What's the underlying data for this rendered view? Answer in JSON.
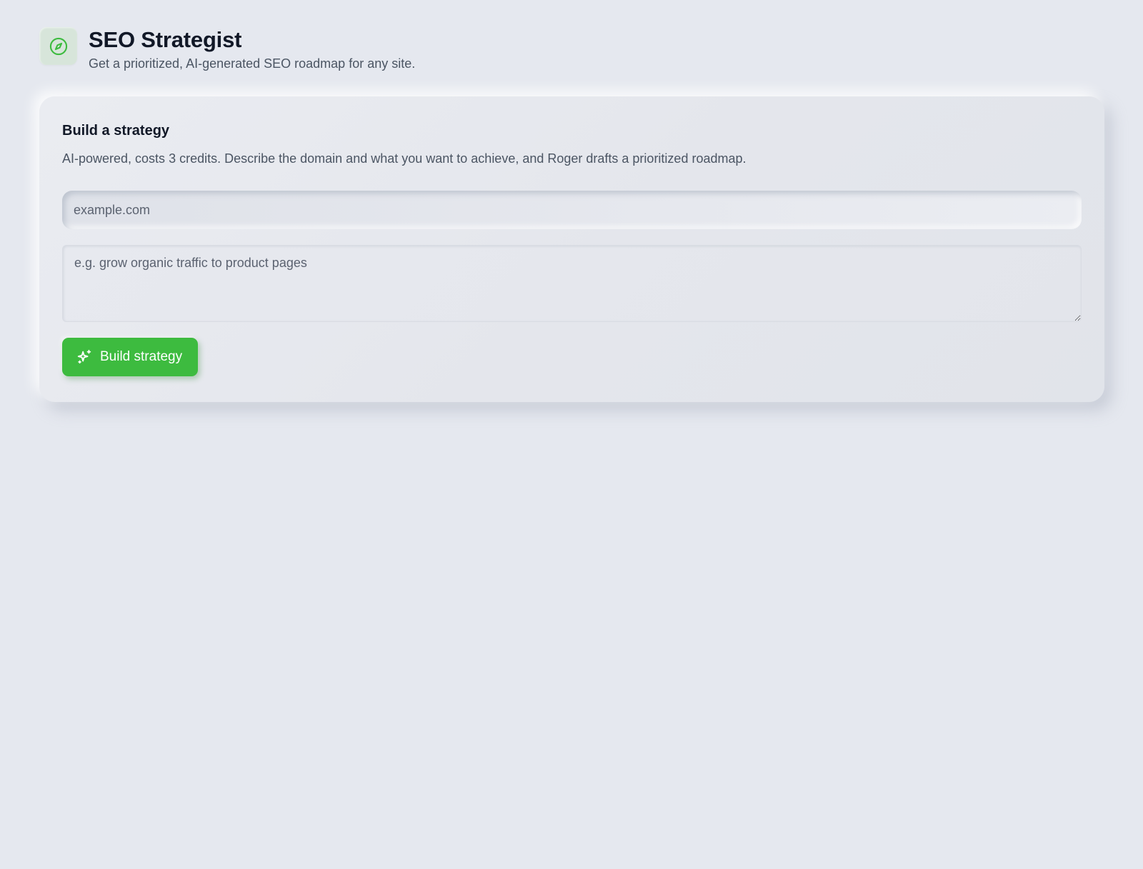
{
  "header": {
    "icon": "compass-icon",
    "title": "SEO Strategist",
    "subtitle": "Get a prioritized, AI-generated SEO roadmap for any site."
  },
  "card": {
    "title": "Build a strategy",
    "description": "AI-powered, costs 3 credits. Describe the domain and what you want to achieve, and Roger drafts a prioritized roadmap.",
    "domain_input": {
      "value": "",
      "placeholder": "example.com"
    },
    "goal_textarea": {
      "value": "",
      "placeholder": "e.g. grow organic traffic to product pages"
    },
    "build_button": {
      "label": "Build strategy",
      "icon": "sparkles-icon"
    }
  },
  "colors": {
    "accent": "#3dbb3f",
    "background": "#e5e8ef",
    "icon_tile": "#d7e5da"
  }
}
